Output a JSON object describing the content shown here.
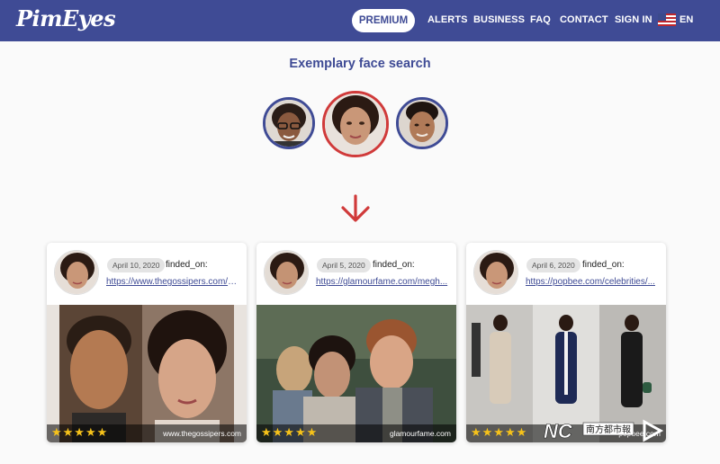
{
  "header": {
    "logo": "PimEyes",
    "premium_label": "PREMIUM",
    "nav": [
      "ALERTS",
      "BUSINESS",
      "FAQ",
      "CONTACT",
      "SIGN IN"
    ],
    "language": "EN"
  },
  "heading": "Exemplary face search",
  "colors": {
    "brand": "#3f4b95",
    "accent_red": "#d03a3a",
    "star": "#f6c21a"
  },
  "results": [
    {
      "date": "April 10, 2020",
      "found_label": "finded_on:",
      "url": "https://www.thegossipers.com/g...",
      "stars": "★★★★★",
      "source": "www.thegossipers.com"
    },
    {
      "date": "April 5, 2020",
      "found_label": "finded_on:",
      "url": "https://glamourfame.com/megh...",
      "stars": "★★★★★",
      "source": "glamourfame.com"
    },
    {
      "date": "April 6, 2020",
      "found_label": "finded_on:",
      "url": "https://popbee.com/celebrities/...",
      "stars": "★★★★★",
      "source": "popbee.com"
    }
  ],
  "watermark": {
    "text": "NC",
    "cn_text": "南方都市報"
  }
}
